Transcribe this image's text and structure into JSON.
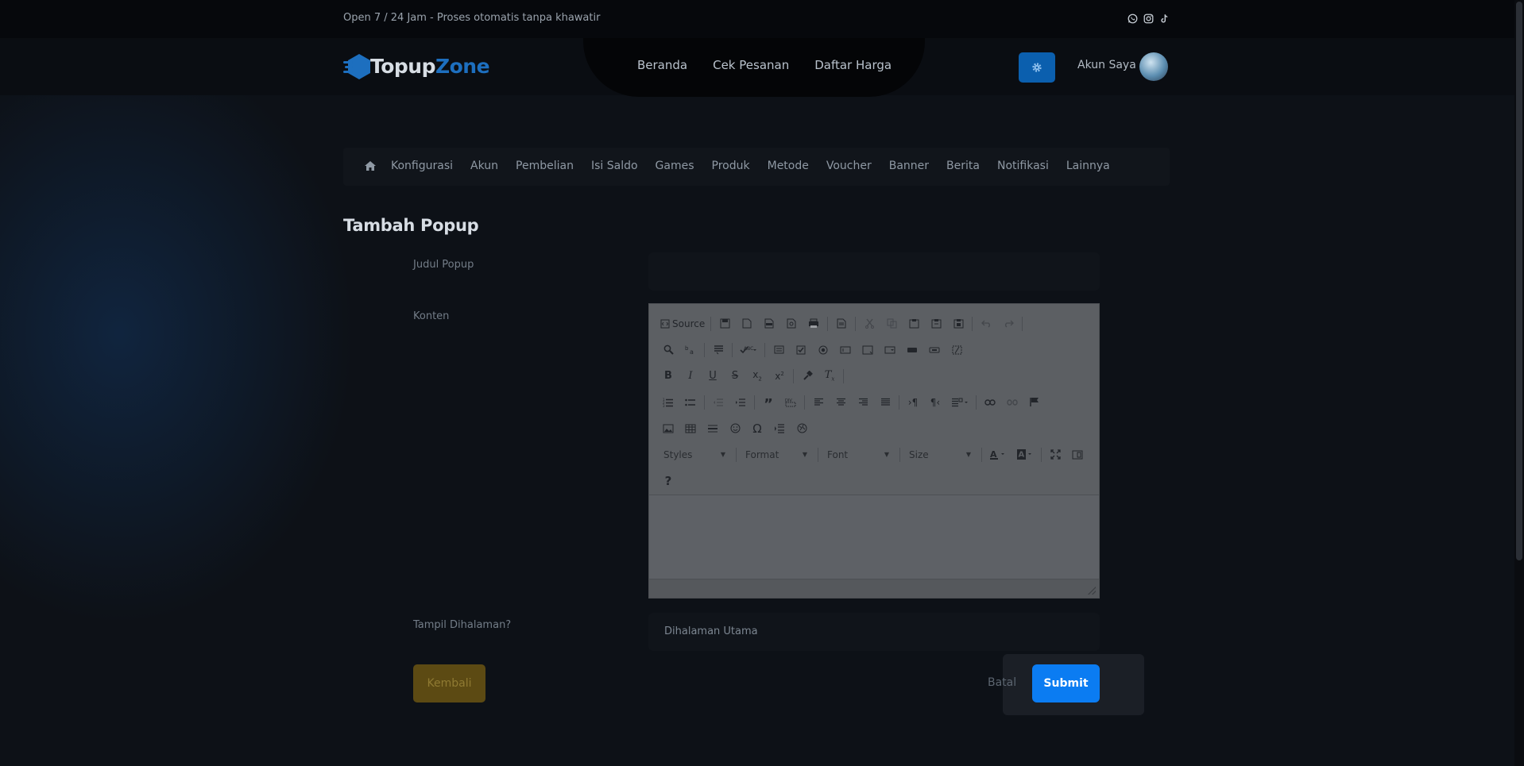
{
  "topbar": {
    "tagline": "Open 7 / 24 Jam - Proses otomatis tanpa khawatir",
    "social_icons": [
      "whatsapp-icon",
      "instagram-icon",
      "tiktok-icon"
    ]
  },
  "header": {
    "logo": {
      "part1": "Topup",
      "part2": "Zone"
    },
    "nav": [
      {
        "label": "Beranda"
      },
      {
        "label": "Cek Pesanan"
      },
      {
        "label": "Daftar Harga"
      }
    ],
    "account_label": "Akun Saya"
  },
  "admin_nav": {
    "items": [
      "Konfigurasi",
      "Akun",
      "Pembelian",
      "Isi Saldo",
      "Games",
      "Produk",
      "Metode",
      "Voucher",
      "Banner",
      "Berita",
      "Notifikasi",
      "Lainnya"
    ]
  },
  "form": {
    "title": "Tambah Popup",
    "judul_label": "Judul Popup",
    "judul_value": "",
    "konten_label": "Konten",
    "tampil_label": "Tampil Dihalaman?",
    "tampil_value": "Dihalaman Utama",
    "back_label": "Kembali",
    "cancel_label": "Batal",
    "submit_label": "Submit"
  },
  "editor": {
    "source_label": "Source",
    "combos": {
      "styles": "Styles",
      "format": "Format",
      "font": "Font",
      "size": "Size"
    },
    "help": "?"
  },
  "colors": {
    "accent": "#0b7cf2",
    "back_button": "#5c4a13",
    "settings_button": "#0b5fae"
  }
}
